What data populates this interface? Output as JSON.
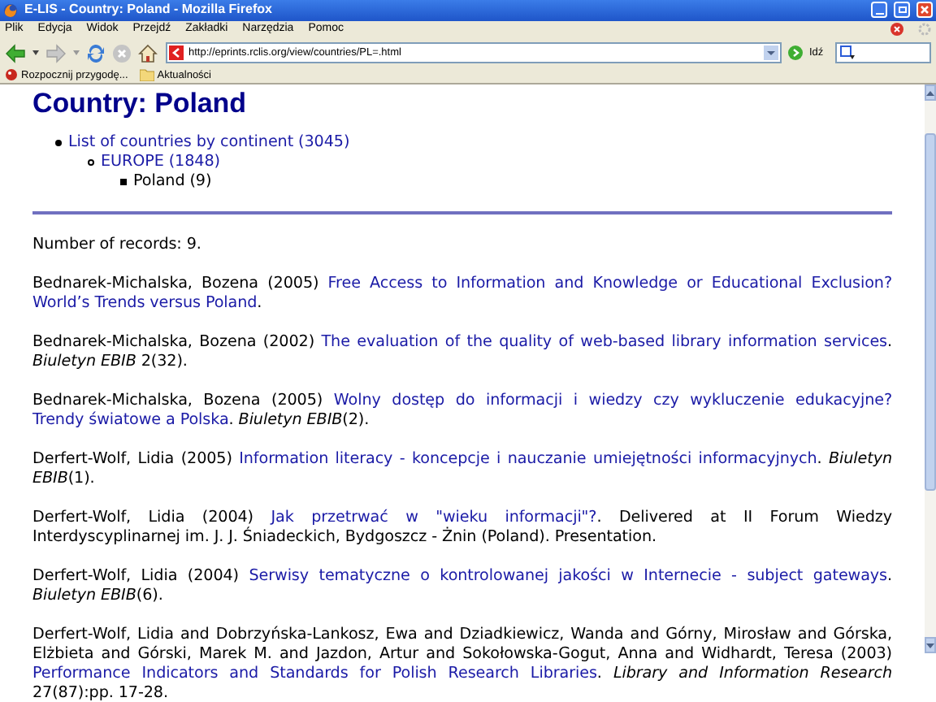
{
  "window": {
    "title": "E-LIS - Country: Poland - Mozilla Firefox"
  },
  "menu": [
    "Plik",
    "Edycja",
    "Widok",
    "Przejdź",
    "Zakładki",
    "Narzędzia",
    "Pomoc"
  ],
  "address_bar": {
    "value": "http://eprints.rclis.org/view/countries/PL=.html"
  },
  "go_button": "Idź",
  "bookmarks": [
    {
      "kind": "page",
      "label": "Rozpocznij przygodę..."
    },
    {
      "kind": "folder",
      "label": "Aktualności"
    }
  ],
  "page": {
    "heading": "Country: Poland",
    "tree": [
      {
        "label": "List of countries by continent (3045)",
        "link": true,
        "children": [
          {
            "label": "EUROPE (1848)",
            "link": true,
            "children": [
              {
                "label": "Poland (9)",
                "link": false
              }
            ]
          }
        ]
      }
    ],
    "record_count": "Number of records: 9.",
    "records": [
      [
        {
          "kind": "text",
          "text": "Bednarek-Michalska, Bozena (2005) "
        },
        {
          "kind": "link",
          "lines": [
            "Free Access to Information and Knowledge or Educational Exclusion?",
            "World’s Trends versus Poland"
          ]
        },
        {
          "kind": "text",
          "text": "."
        }
      ],
      [
        {
          "kind": "text",
          "text": "Bednarek-Michalska, Bozena (2002) "
        },
        {
          "kind": "link",
          "text": "The evaluation of the quality of web-based library information services"
        },
        {
          "kind": "text",
          "text": ". "
        },
        {
          "kind": "italic",
          "text": "Biuletyn EBIB"
        },
        {
          "kind": "text",
          "text": " 2(32)."
        }
      ],
      [
        {
          "kind": "text",
          "text": "Bednarek-Michalska, Bozena (2005) "
        },
        {
          "kind": "link",
          "lines": [
            "Wolny dostęp do informacji i wiedzy czy wykluczenie edukacyjne?",
            "Trendy światowe a Polska"
          ]
        },
        {
          "kind": "text",
          "text": ". "
        },
        {
          "kind": "italic",
          "text": "Biuletyn EBIB"
        },
        {
          "kind": "text",
          "text": "(2)."
        }
      ],
      [
        {
          "kind": "text",
          "text": "Derfert-Wolf, Lidia (2005) "
        },
        {
          "kind": "link",
          "text": "Information literacy - koncepcje i nauczanie umiejętności informacyjnych"
        },
        {
          "kind": "text",
          "text": ". "
        },
        {
          "kind": "italic",
          "text": "Biuletyn EBIB"
        },
        {
          "kind": "text",
          "text": "(1)."
        }
      ],
      [
        {
          "kind": "text",
          "text": "Derfert-Wolf, Lidia (2004) "
        },
        {
          "kind": "link",
          "text": "Jak przetrwać w \"wieku informacji\"?"
        },
        {
          "kind": "text",
          "text": ". Delivered at II Forum Wiedzy Interdyscyplinarnej im. J. J. Śniadeckich, Bydgoszcz - Żnin (Poland). Presentation."
        }
      ],
      [
        {
          "kind": "text",
          "text": "Derfert-Wolf, Lidia (2004) "
        },
        {
          "kind": "link",
          "text": "Serwisy tematyczne o kontrolowanej jakości w Internecie - subject gateways"
        },
        {
          "kind": "text",
          "text": ". "
        },
        {
          "kind": "italic",
          "text": "Biuletyn EBIB"
        },
        {
          "kind": "text",
          "text": "(6)."
        }
      ],
      [
        {
          "kind": "text",
          "text": "Derfert-Wolf, Lidia and Dobrzyńska-Lankosz, Ewa and Dziadkiewicz, Wanda and Górny, Mirosław and Górska, Elżbieta and Górski, Marek M. and Jazdon, Artur and Sokołowska-Gogut, Anna and Widhardt, Teresa (2003) "
        },
        {
          "kind": "link",
          "text": "Performance Indicators and Standards for Polish Research Libraries"
        },
        {
          "kind": "text",
          "text": ". "
        },
        {
          "kind": "italic",
          "text": "Library and Information Research"
        },
        {
          "kind": "text",
          "text": " 27(87):pp. 17-28."
        }
      ]
    ]
  }
}
